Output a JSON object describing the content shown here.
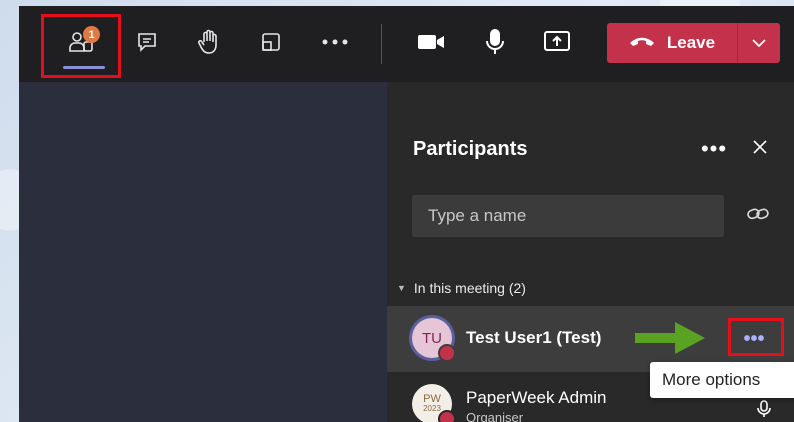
{
  "toolbar": {
    "participants_badge": "1",
    "leave_label": "Leave",
    "icons": [
      "people-icon",
      "chat-icon",
      "raise-hand-icon",
      "rooms-icon",
      "more-icon",
      "camera-icon",
      "mic-icon",
      "share-icon",
      "phone-icon",
      "chevron-down-icon"
    ]
  },
  "panel": {
    "title": "Participants",
    "more_glyph": "•••",
    "search_placeholder": "Type a name",
    "section_label": "In this meeting (2)",
    "participants": [
      {
        "initials": "TU",
        "name": "Test User1 (Test)",
        "role": ""
      },
      {
        "initials": "PW",
        "initials_sub": "2023",
        "name": "PaperWeek Admin",
        "role": "Organiser"
      }
    ],
    "row_more_glyph": "•••"
  },
  "tooltip": {
    "text": "More options"
  },
  "colors": {
    "accent": "#8b8fd8",
    "leave": "#c4314b",
    "highlight": "#e3101c",
    "arrow": "#5aa322",
    "badge": "#e07a45"
  }
}
